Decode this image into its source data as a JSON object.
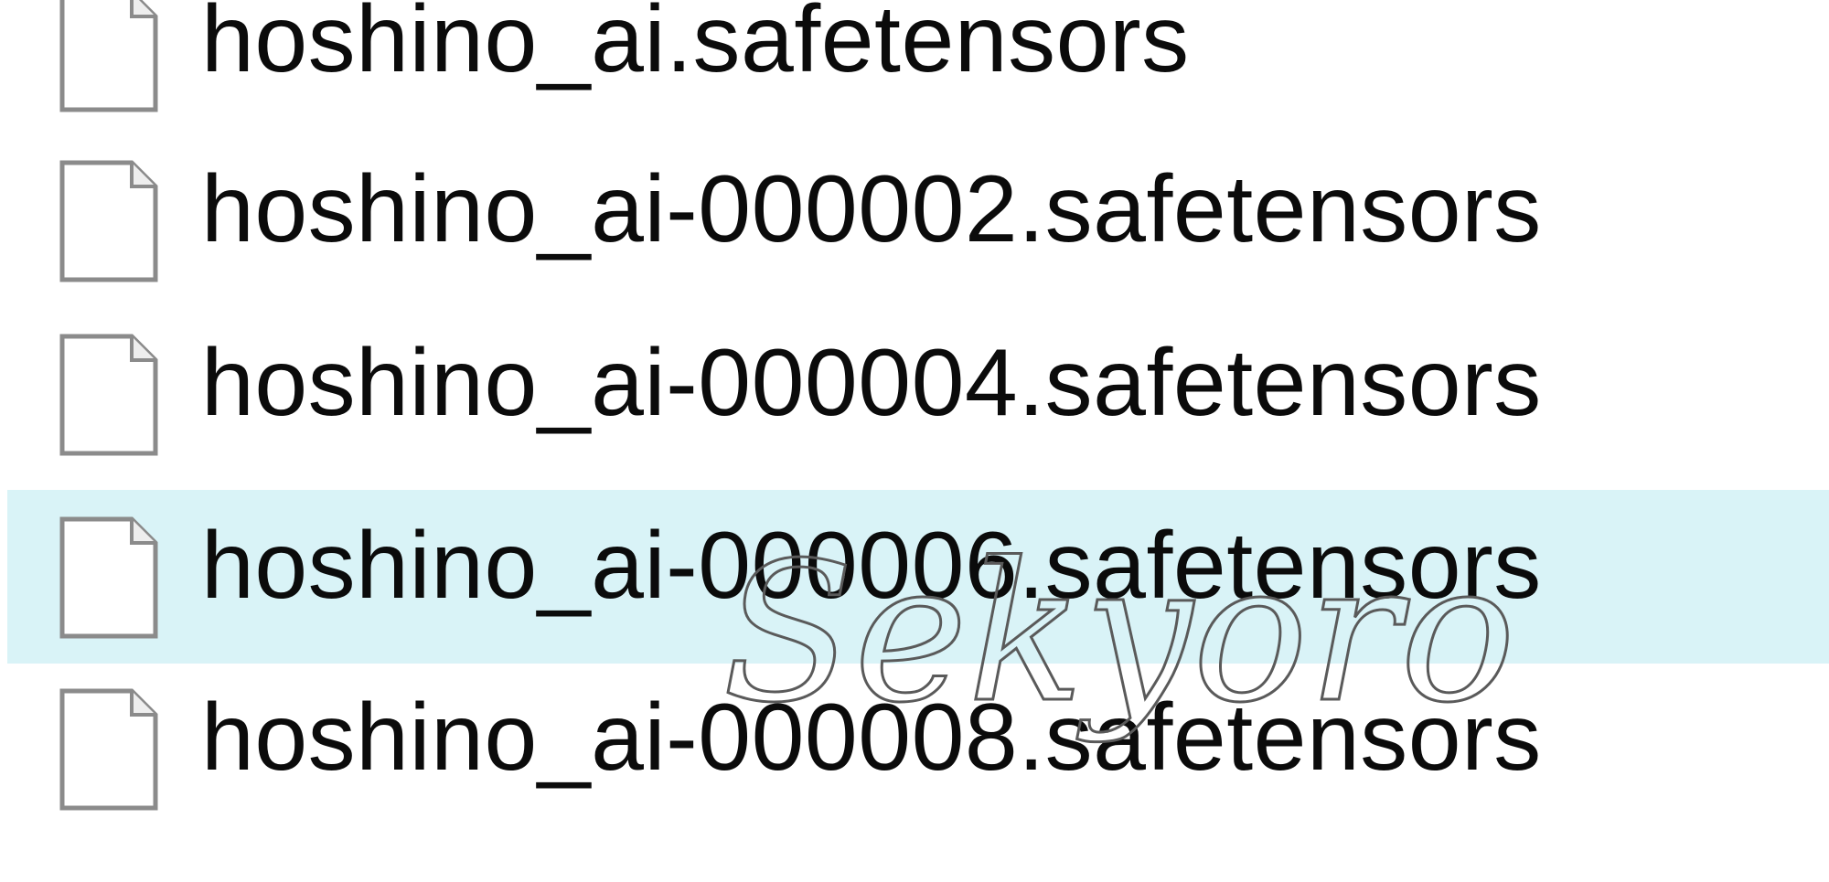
{
  "files": [
    {
      "name": "hoshino_ai.safetensors",
      "icon": "file-icon",
      "selected": false
    },
    {
      "name": "hoshino_ai-000002.safetensors",
      "icon": "file-icon",
      "selected": false
    },
    {
      "name": "hoshino_ai-000004.safetensors",
      "icon": "file-icon",
      "selected": false
    },
    {
      "name": "hoshino_ai-000006.safetensors",
      "icon": "file-icon",
      "selected": true
    },
    {
      "name": "hoshino_ai-000008.safetensors",
      "icon": "file-icon",
      "selected": false
    }
  ],
  "watermark": {
    "text": "Sekyoro"
  },
  "colors": {
    "selection_background": "#d9f3f7",
    "text": "#0b0b0b",
    "watermark": "#5a5a5a"
  }
}
